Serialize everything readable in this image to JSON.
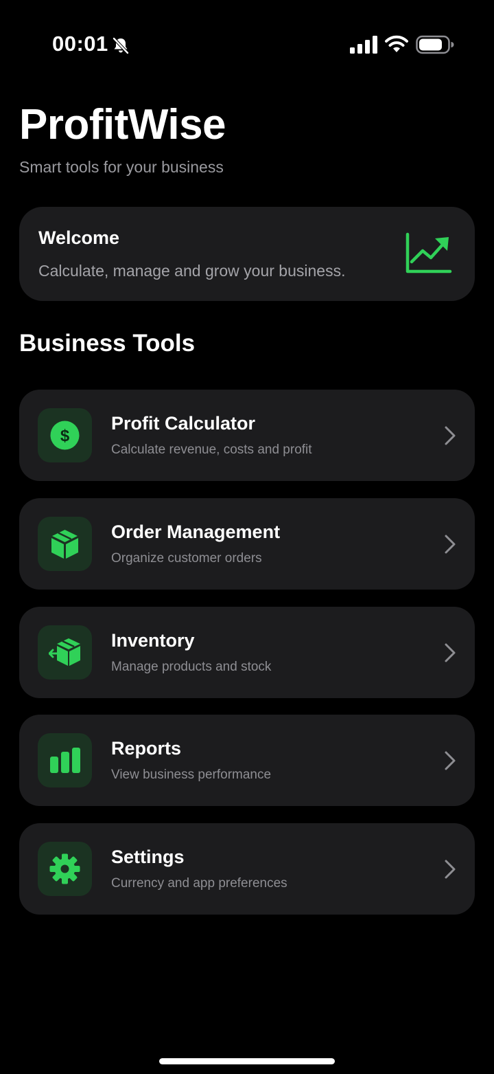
{
  "status_bar": {
    "time": "00:01"
  },
  "header": {
    "title": "ProfitWise",
    "subtitle": "Smart tools for your business"
  },
  "welcome": {
    "title": "Welcome",
    "text": "Calculate, manage and grow your business."
  },
  "section_title": "Business Tools",
  "tools": [
    {
      "title": "Profit Calculator",
      "subtitle": "Calculate revenue, costs and profit",
      "icon": "dollar-icon"
    },
    {
      "title": "Order Management",
      "subtitle": "Organize customer orders",
      "icon": "box-icon"
    },
    {
      "title": "Inventory",
      "subtitle": "Manage products and stock",
      "icon": "shipping-box-icon"
    },
    {
      "title": "Reports",
      "subtitle": "View business performance",
      "icon": "bar-chart-icon"
    },
    {
      "title": "Settings",
      "subtitle": "Currency and app preferences",
      "icon": "gear-icon"
    }
  ],
  "colors": {
    "background": "#000000",
    "card": "#1c1c1e",
    "accent": "#30d158",
    "icon_box": "#1b3322",
    "secondary_text": "#8e8e93"
  }
}
